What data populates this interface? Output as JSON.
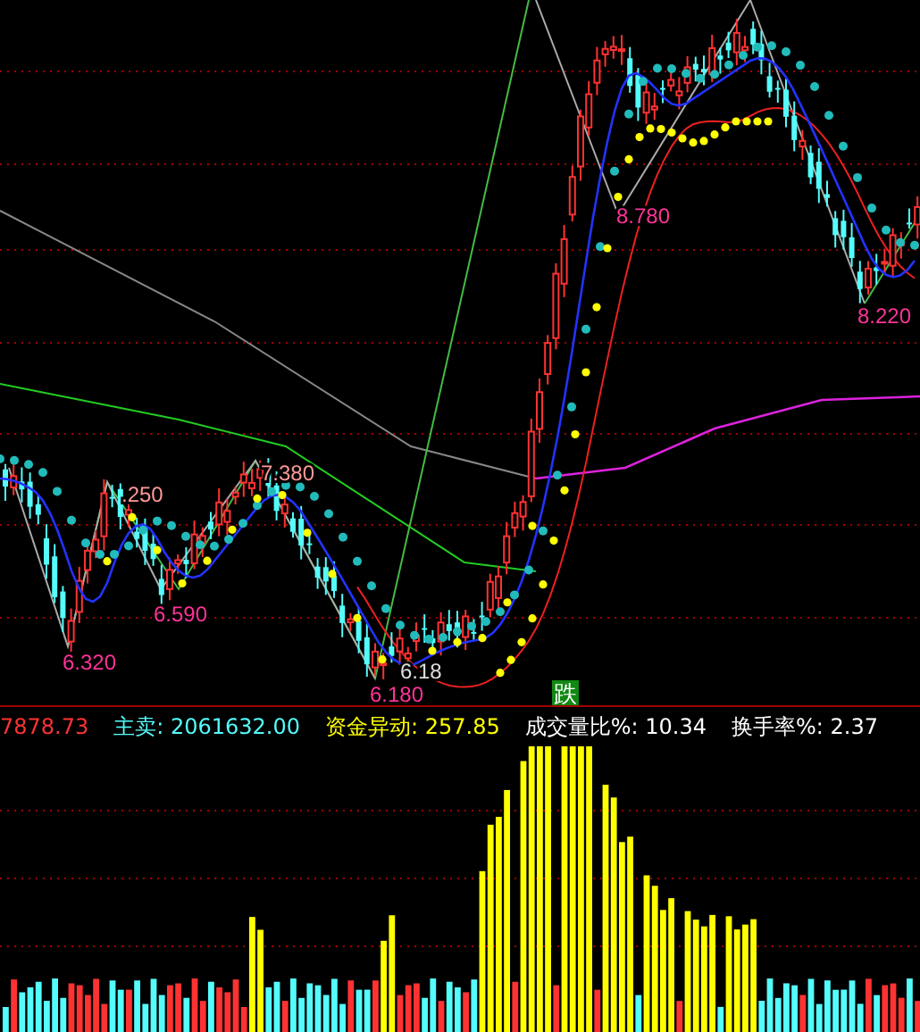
{
  "price_labels": [
    {
      "text": ".250",
      "color": "#ff9999"
    },
    {
      "text": "7.380",
      "color": "#ff9999"
    },
    {
      "text": "6.320",
      "color": "#ff3399"
    },
    {
      "text": "6.590",
      "color": "#ff3399"
    },
    {
      "text": "6.18",
      "color": "#dddddd"
    },
    {
      "text": "6.180",
      "color": "#ff3399"
    },
    {
      "text": "8.780",
      "color": "#ff3399"
    },
    {
      "text": "8.220",
      "color": "#ff3399"
    }
  ],
  "signal": {
    "text": "跌"
  },
  "indicator_bar": [
    {
      "text": "7878.73",
      "color": "#ff3232"
    },
    {
      "text": "主卖: 2061632.00",
      "color": "#54fcfc"
    },
    {
      "text": "资金异动: 257.85",
      "color": "#ffff00"
    },
    {
      "text": "成交量比%: 10.34",
      "color": "#ffffff"
    },
    {
      "text": "换手率%: 2.37",
      "color": "#ffffff"
    }
  ]
}
